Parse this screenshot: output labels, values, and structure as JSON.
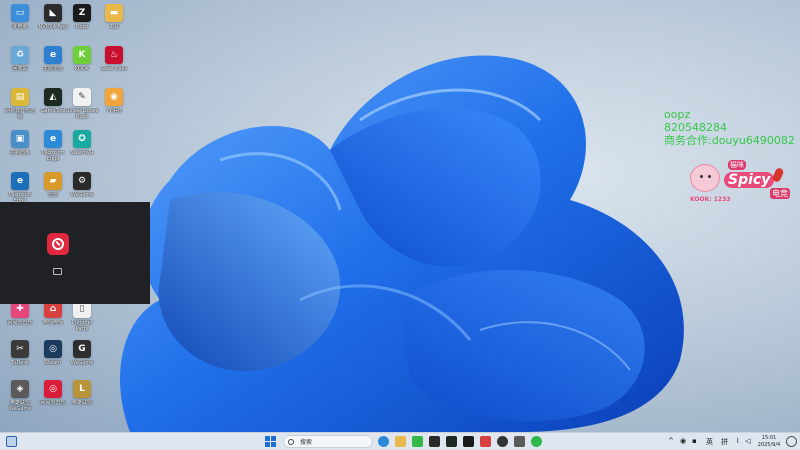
{
  "desktop": {
    "icons": [
      {
        "id": "computer",
        "label": "此电脑",
        "color": "#3a8fd8",
        "glyph": "▭"
      },
      {
        "id": "nvidia",
        "label": "NVIDIA App",
        "color": "#2b2b2b",
        "glyph": "◣"
      },
      {
        "id": "zapp",
        "label": "Oopz",
        "color": "#1b1b1b",
        "glyph": "Z"
      },
      {
        "id": "folder",
        "label": "工具",
        "color": "#e8b94a",
        "glyph": "▬"
      },
      {
        "id": "recycle",
        "label": "回收站",
        "color": "#6aa8d8",
        "glyph": "♻"
      },
      {
        "id": "edge-top",
        "label": "主题浏览",
        "color": "#2f7fd0",
        "glyph": "e"
      },
      {
        "id": "kook",
        "label": "KOOK",
        "color": "#6fcf3a",
        "glyph": "K"
      },
      {
        "id": "rednote",
        "label": "Steel Calls",
        "color": "#c8102e",
        "glyph": "♨"
      },
      {
        "id": "ticket",
        "label": "网易云音乐游戏",
        "color": "#d9b83a",
        "glyph": "▤"
      },
      {
        "id": "tarkov",
        "label": "GameTool",
        "color": "#1c2a22",
        "glyph": "◭"
      },
      {
        "id": "goose",
        "label": "Goose Goose Duck",
        "color": "#f2f2f2",
        "glyph": "✎"
      },
      {
        "id": "owl",
        "label": "YY语音",
        "color": "#f0a43a",
        "glyph": "◉"
      },
      {
        "id": "monitor",
        "label": "控制面板",
        "color": "#4a90c8",
        "glyph": "▣"
      },
      {
        "id": "edge2",
        "label": "Microsoft Edge",
        "color": "#2c8ad8",
        "glyph": "e"
      },
      {
        "id": "teal",
        "label": "SteamVR",
        "color": "#18a9a0",
        "glyph": "✪"
      },
      {
        "id": "edge3",
        "label": "Microsoft Edge",
        "color": "#1b6fb8",
        "glyph": "e"
      },
      {
        "id": "bus",
        "label": "迅雷",
        "color": "#d89a2a",
        "glyph": "▰"
      },
      {
        "id": "steamgear",
        "label": "WeGame",
        "color": "#2a2a2a",
        "glyph": "⚙"
      },
      {
        "id": "pink",
        "label": "网易云音乐",
        "color": "#e8457a",
        "glyph": "✚"
      },
      {
        "id": "car",
        "label": "哔哩哔哩",
        "color": "#d84040",
        "glyph": "⌂"
      },
      {
        "id": "doc",
        "label": "Pummel Party",
        "color": "#f0f0f0",
        "glyph": "▯"
      },
      {
        "id": "capcut",
        "label": "ToDesk",
        "color": "#3a3a3a",
        "glyph": "✂"
      },
      {
        "id": "steam",
        "label": "Steam",
        "color": "#1b3a5c",
        "glyph": "◎"
      },
      {
        "id": "wegame",
        "label": "WeGame",
        "color": "#2e2e2e",
        "glyph": "G"
      },
      {
        "id": "grey",
        "label": "英雄联盟WeGame",
        "color": "#5a5a5a",
        "glyph": "◈"
      },
      {
        "id": "netease",
        "label": "网易云音乐",
        "color": "#d81e3a",
        "glyph": "◎"
      },
      {
        "id": "lol",
        "label": "英雄联盟",
        "color": "#b8943a",
        "glyph": "L"
      }
    ]
  },
  "overlay": {
    "line1": "oopz",
    "line2": "820548284",
    "line3": "商务合作:douyu6490082"
  },
  "badge": {
    "word": "Spicy",
    "top": "猫咪",
    "side": "电竞",
    "kook": "KOOK: 1233"
  },
  "taskbar": {
    "search_placeholder": "搜索",
    "lang": "英",
    "ime": "拼",
    "time": "15:01",
    "date": "2025/9/4"
  }
}
